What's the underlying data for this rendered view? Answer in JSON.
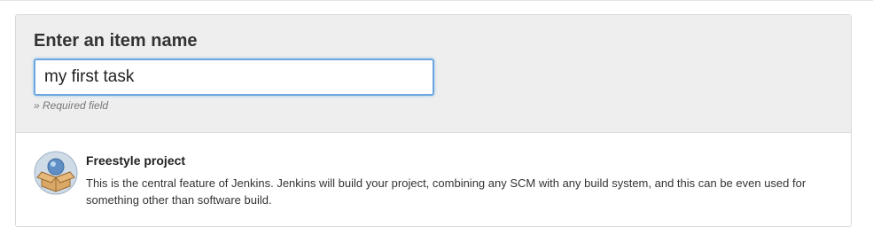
{
  "name_section": {
    "title": "Enter an item name",
    "input_value": "my first task",
    "required_note": "» Required field"
  },
  "item_types": [
    {
      "icon": "freestyle-project-icon",
      "title": "Freestyle project",
      "description": "This is the central feature of Jenkins. Jenkins will build your project, combining any SCM with any build system, and this can be even used for something other than software build."
    }
  ],
  "colors": {
    "input_focus_border": "#6ea6e0",
    "section_background": "#eeeeee"
  }
}
